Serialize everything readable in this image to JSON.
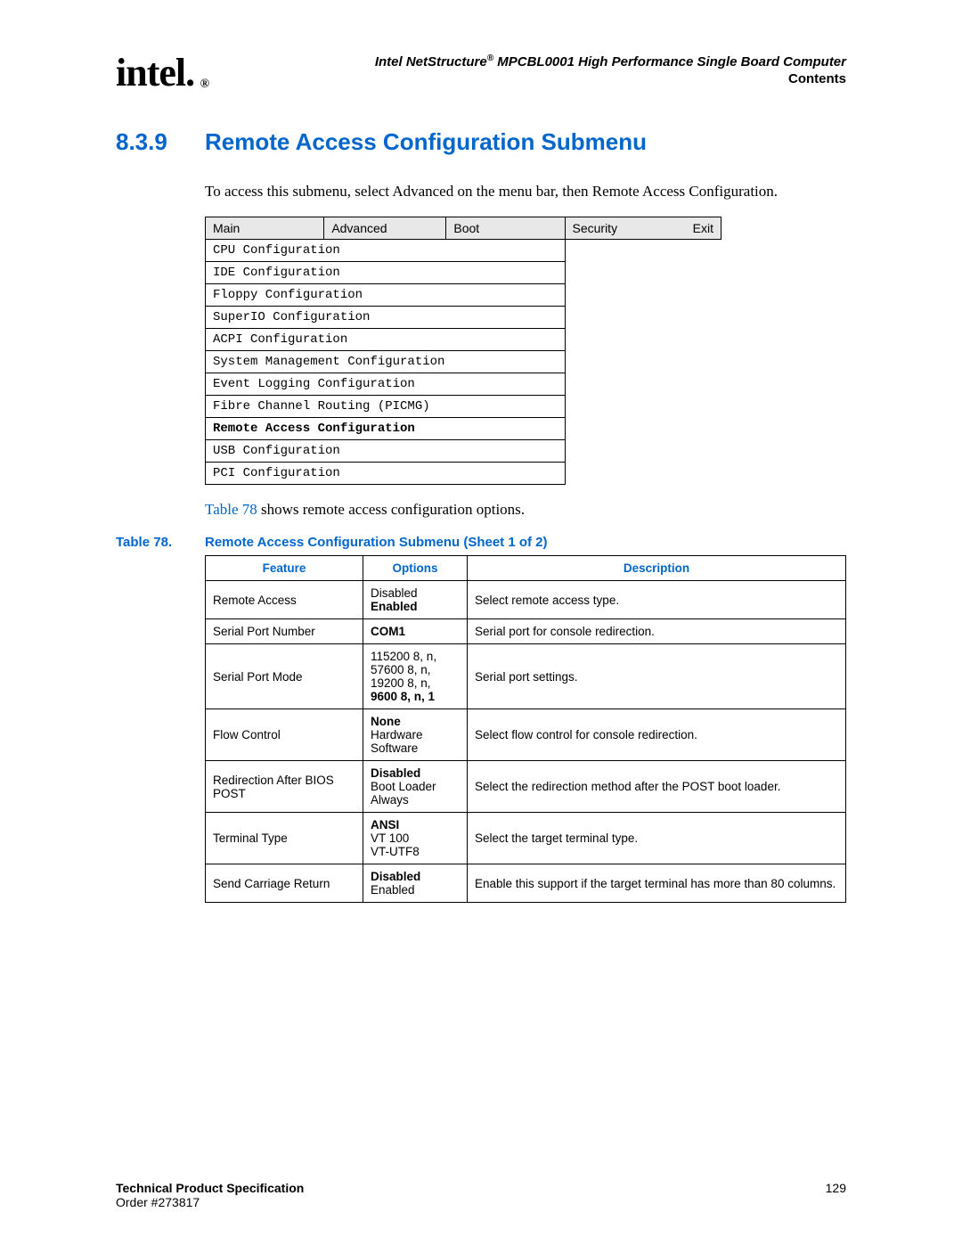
{
  "header": {
    "logo_text": "intel",
    "doc_title_pre": "Intel NetStructure",
    "doc_title_post": " MPCBL0001 High Performance Single Board Computer",
    "section_label": "Contents"
  },
  "heading": {
    "number": "8.3.9",
    "title": "Remote Access Configuration Submenu"
  },
  "intro_text": "To access this submenu, select Advanced on the menu bar, then Remote Access Configuration.",
  "menu_tabs": [
    "Main",
    "Advanced",
    "Boot",
    "Security",
    "Exit"
  ],
  "menu_items": [
    "CPU Configuration",
    "IDE Configuration",
    "Floppy Configuration",
    "SuperIO Configuration",
    "ACPI Configuration",
    "System Management Configuration",
    "Event Logging Configuration",
    "Fibre Channel Routing (PICMG)",
    "Remote Access Configuration",
    "USB Configuration",
    "PCI Configuration"
  ],
  "menu_bold_index": 8,
  "post_menu_link": "Table 78",
  "post_menu_rest": " shows remote access configuration options.",
  "table_caption_num": "Table 78.",
  "table_caption_title": "Remote Access Configuration Submenu (Sheet 1 of 2)",
  "config_headers": {
    "feature": "Feature",
    "options": "Options",
    "description": "Description"
  },
  "config_rows": [
    {
      "feature": "Remote Access",
      "options": [
        {
          "text": "Disabled",
          "bold": false
        },
        {
          "text": "Enabled",
          "bold": true
        }
      ],
      "description": "Select remote access type."
    },
    {
      "feature": "Serial Port Number",
      "options": [
        {
          "text": "COM1",
          "bold": true
        }
      ],
      "description": "Serial port for console redirection."
    },
    {
      "feature": "Serial Port Mode",
      "options": [
        {
          "text": "115200 8, n,",
          "bold": false
        },
        {
          "text": "57600 8, n,",
          "bold": false
        },
        {
          "text": "19200 8, n,",
          "bold": false
        },
        {
          "text": "9600 8, n, 1",
          "bold": true
        }
      ],
      "description": "Serial port settings."
    },
    {
      "feature": "Flow Control",
      "options": [
        {
          "text": "None",
          "bold": true
        },
        {
          "text": "Hardware",
          "bold": false
        },
        {
          "text": "Software",
          "bold": false
        }
      ],
      "description": "Select flow control for console redirection."
    },
    {
      "feature": "Redirection After BIOS POST",
      "options": [
        {
          "text": "Disabled",
          "bold": true
        },
        {
          "text": "Boot Loader",
          "bold": false
        },
        {
          "text": "Always",
          "bold": false
        }
      ],
      "description": "Select the redirection method after the POST boot loader."
    },
    {
      "feature": "Terminal Type",
      "options": [
        {
          "text": "ANSI",
          "bold": true
        },
        {
          "text": "VT 100",
          "bold": false
        },
        {
          "text": "VT-UTF8",
          "bold": false
        }
      ],
      "description": "Select the target terminal type."
    },
    {
      "feature": "Send Carriage Return",
      "options": [
        {
          "text": "Disabled",
          "bold": true
        },
        {
          "text": "Enabled",
          "bold": false
        }
      ],
      "description": "Enable this support if the target terminal has more than 80 columns."
    }
  ],
  "footer": {
    "tps": "Technical Product Specification",
    "order": "Order #273817",
    "page": "129"
  }
}
